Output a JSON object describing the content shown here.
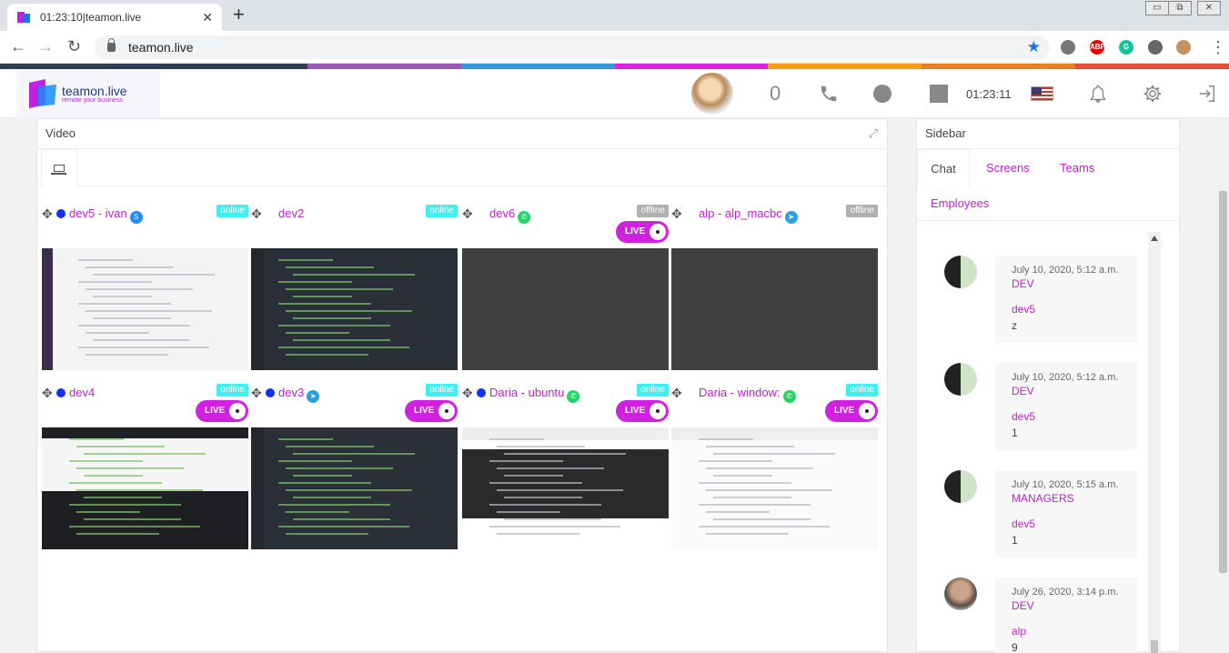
{
  "browser": {
    "tab_title": "01:23:10|teamon.live",
    "tab_close": "✕",
    "new_tab": "+",
    "url": "teamon.live",
    "back": "←",
    "forward": "→",
    "reload": "↻",
    "star": "★",
    "menu": "⋮",
    "win_min": "▭",
    "win_restore": "⧉",
    "win_close": "✕",
    "extensions": [
      "ABP",
      "G"
    ]
  },
  "stripe_colors": [
    "#2c3e50",
    "#2c3e50",
    "#9b59b6",
    "#3498db",
    "#e020e0",
    "#f39c12",
    "#e67e22",
    "#e74c3c"
  ],
  "header": {
    "logo_text": "teamon.live",
    "logo_sub": "remote your business",
    "count": "0",
    "time": "01:23:11"
  },
  "video": {
    "title": "Video",
    "expand_glyph": "⤢",
    "move_glyph": "✥",
    "live_label": "LIVE",
    "tiles": [
      {
        "name": "dev5 - ivan",
        "dot": true,
        "app": "skype",
        "app_glyph": "S",
        "status": "online",
        "live": false,
        "screen": "doc"
      },
      {
        "name": "dev2",
        "dot": false,
        "app": "",
        "app_glyph": "",
        "status": "online",
        "live": false,
        "screen": "ide"
      },
      {
        "name": "dev6",
        "dot": false,
        "app": "whatsapp",
        "app_glyph": "✆",
        "status": "offline",
        "live": true,
        "screen": "blank"
      },
      {
        "name": "alp - alp_macbc",
        "dot": false,
        "app": "telegram",
        "app_glyph": "➤",
        "status": "offline",
        "live": false,
        "screen": "blank"
      },
      {
        "name": "dev4",
        "dot": true,
        "app": "",
        "app_glyph": "",
        "status": "online",
        "live": true,
        "screen": "desktop"
      },
      {
        "name": "dev3",
        "dot": true,
        "app": "telegram",
        "app_glyph": "➤",
        "status": "online",
        "live": true,
        "screen": "ide"
      },
      {
        "name": "Daria - ubuntu",
        "dot": true,
        "app": "whatsapp",
        "app_glyph": "✆",
        "status": "online",
        "live": true,
        "screen": "web"
      },
      {
        "name": "Daria - window:",
        "dot": false,
        "app": "whatsapp",
        "app_glyph": "✆",
        "status": "online",
        "live": true,
        "screen": "grid"
      }
    ]
  },
  "sidebar": {
    "title": "Sidebar",
    "tabs": [
      "Chat",
      "Screens",
      "Teams",
      "Employees"
    ],
    "messages": [
      {
        "time": "July 10, 2020, 5:12 a.m.",
        "group": "DEV",
        "user": "dev5",
        "text": "z"
      },
      {
        "time": "July 10, 2020, 5:12 a.m.",
        "group": "DEV",
        "user": "dev5",
        "text": "1"
      },
      {
        "time": "July 10, 2020, 5:15 a.m.",
        "group": "MANAGERS",
        "user": "dev5",
        "text": "1"
      },
      {
        "time": "July 26, 2020, 3:14 p.m.",
        "group": "DEV",
        "user": "alp",
        "text": "9"
      }
    ]
  },
  "colors": {
    "accent": "#c020d0",
    "online": "#40f0f0",
    "offline": "#b0b0b0",
    "live": "#d020e0"
  }
}
